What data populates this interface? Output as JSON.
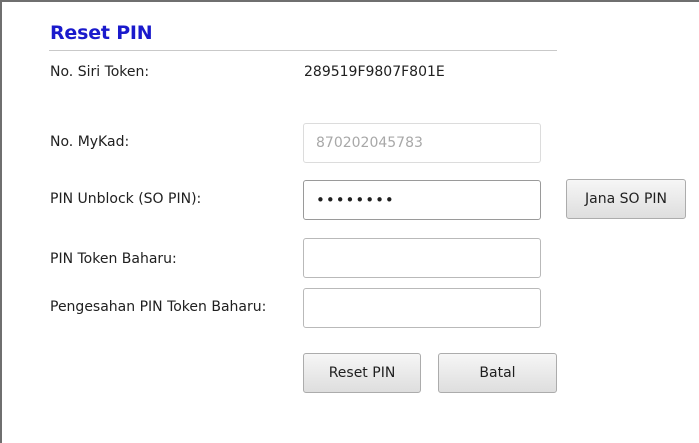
{
  "form": {
    "title": "Reset PIN",
    "fields": {
      "token_serial": {
        "label": "No. Siri Token:",
        "value": "289519F9807F801E"
      },
      "mykad": {
        "label": "No. MyKad:",
        "value": "870202045783"
      },
      "so_pin": {
        "label": "PIN Unblock (SO PIN):",
        "value": "••••••••"
      },
      "new_pin": {
        "label": "PIN Token Baharu:",
        "value": ""
      },
      "confirm_pin": {
        "label": "Pengesahan PIN Token Baharu:",
        "value": ""
      }
    },
    "buttons": {
      "generate_so_pin": "Jana SO PIN",
      "reset_pin": "Reset PIN",
      "cancel": "Batal"
    }
  }
}
